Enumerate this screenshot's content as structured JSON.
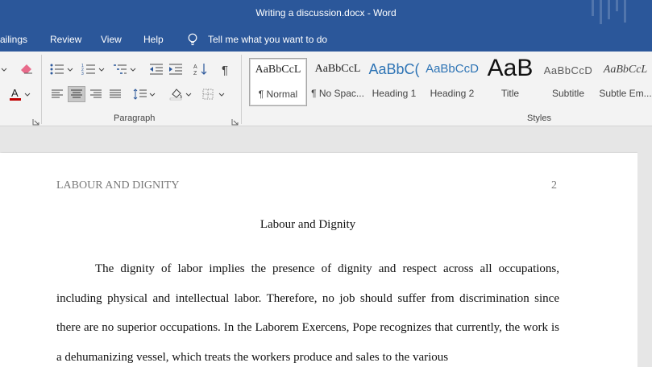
{
  "window": {
    "title": "Writing a discussion.docx  -  Word"
  },
  "menu": {
    "items": [
      "ailings",
      "Review",
      "View",
      "Help"
    ],
    "tell_me": "Tell me what you want to do"
  },
  "ribbon": {
    "paragraph_label": "Paragraph",
    "styles_label": "Styles",
    "styles": [
      {
        "sample": "AaBbCcL",
        "name": "¶ Normal"
      },
      {
        "sample": "AaBbCcL",
        "name": "¶ No Spac..."
      },
      {
        "sample": "AaBbC(",
        "name": "Heading 1"
      },
      {
        "sample": "AaBbCcD",
        "name": "Heading 2"
      },
      {
        "sample": "AaB",
        "name": "Title"
      },
      {
        "sample": "AaBbCcD",
        "name": "Subtitle"
      },
      {
        "sample": "AaBbCcL",
        "name": "Subtle Em..."
      }
    ],
    "colors": {
      "accent": "#2b579a",
      "heading": "#2e74b5",
      "font_color_bar": "#c00000"
    }
  },
  "document": {
    "header_left": "LABOUR AND DIGNITY",
    "page_number": "2",
    "title": "Labour and Dignity",
    "paragraph": "The dignity of labor implies the presence of dignity and respect across all occupations, including physical and intellectual labor. Therefore, no job should suffer from discrimination since there are no superior occupations. In the Laborem Exercens, Pope recognizes that currently, the work is a dehumanizing vessel, which treats the workers produce and sales to the various"
  }
}
